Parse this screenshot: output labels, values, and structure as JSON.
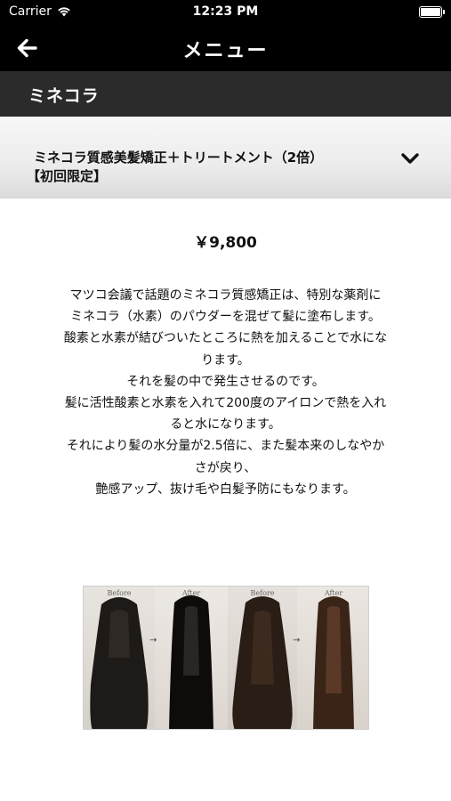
{
  "status_bar": {
    "carrier": "Carrier",
    "time": "12:23 PM"
  },
  "nav": {
    "title": "メニュー"
  },
  "section": {
    "label": "ミネコラ"
  },
  "menu_item": {
    "title_line1": "ミネコラ質感美髪矯正＋トリートメント（2倍）",
    "title_line2": "【初回限定】",
    "price": "￥9,800",
    "description": [
      "マツコ会議で話題のミネコラ質感矯正は、特別な薬剤に",
      "ミネコラ（水素）のパウダーを混ぜて髪に塗布します。",
      "酸素と水素が結びついたところに熱を加えることで水にな",
      "ります。",
      "それを髪の中で発生させるのです。",
      "髪に活性酸素と水素を入れて200度のアイロンで熱を入れ",
      "ると水になります。",
      "それにより髪の水分量が2.5倍に、また髪本来のしなやか",
      "さが戻り、",
      "艶感アップ、抜け毛や白髪予防にもなります。"
    ],
    "photo_labels": [
      "Before",
      "After",
      "Before",
      "After"
    ]
  },
  "icons": {
    "back": "arrow-left-icon",
    "chevron": "chevron-down-icon",
    "wifi": "wifi-icon",
    "battery": "battery-icon"
  },
  "colors": {
    "nav_background": "#000000",
    "section_background": "#2b2b2b",
    "accordion_background": "#ececec",
    "text": "#111111"
  }
}
